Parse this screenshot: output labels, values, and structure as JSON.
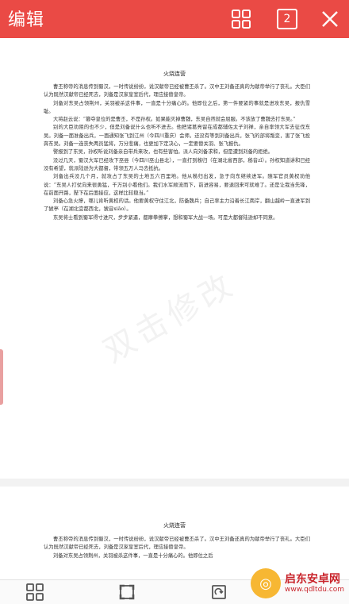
{
  "header": {
    "title": "编辑",
    "page_count": "2"
  },
  "document": {
    "title": "火烧连营",
    "paragraphs": [
      "曹丕称帝的消息传到蜀汉，一时传说纷纷，说汉献帝已经被曹丕杀了。汉中王刘备还真的为献帝举行了丧礼。大臣们认为既然汉献帝已经死去，刘备是汉家皇室后代，理应接替皇帝。",
      "刘备对东吴占领荆州，关羽被杀这件事，一直是十分痛心的。他即位之后，第一件要紧的事就是进攻东吴，报仇雪耻。",
      "大将赵云说：“篡夺皇位的是曹丕，不是孙权。如果能灭掉曹魏，东吴自然就会屈服。不该放了曹魏去打东吴。”",
      "别的大臣劝阻的也不少，但是刘备说什么也听不进去。他把诸葛亮留在成都辅佐太子刘禅，亲自率领大军去征伐东吴。刘备一面准备出兵，一面通知张飞到江州（今四川重庆）会师。还没有等到刘备出兵，张飞的部将叛变，害了张飞投奔东吴。刘备一连丧失两员猛将，万分悲痛，也更加下定决心，一定要替关羽、张飞报仇。",
      "警报到了东吴，孙权听说刘备亲自带兵来攻，也有些害怕。派人向刘备求和，但是遭到刘备的拒绝。",
      "没过几天，蜀汉大军已经攻下巫县（今四川巫山县北），一直打到秭归（在湖北省西部，秭音zǐ）。孙权知道讲和已经没有希望，就派陆逊为大都督，带领五万人马去抵抗。",
      "刘备出兵没几个月，就攻占了东吴的土地五六百里地。他从秭归出发，急于向东继续进军。随军官员黄权劝他说：“东吴人打仗向来很勇猛，千万别小看他们。我们水军顺流而下，前进容易，要退回来可就难了。还是让我当先锋，在前面开路，陛下在后面接应，这样比较稳当。”",
      "刘备心急火燎，哪儿肯听黄权的话。他要黄权守住江北，防备魏兵；自己率主力沿着长江南岸，翻山越岭一直进军到了猇亭（在湖北宜都西北，猇音xiāo）。",
      "东吴将士看到蜀军得寸进尺，步步紧逼，都摩拳擦掌，想和蜀军大战一场。可是大都督陆逊却不同意。"
    ],
    "page2_title": "火烧连营",
    "page2_paragraphs": [
      "曹丕称帝的消息传到蜀汉，一时传说纷纷，说汉献帝已经被曹丕杀了。汉中王刘备还真的为献帝举行了丧礼。大臣们认为既然汉献帝已经死去，刘备是汉家皇室后代，理应接替皇帝。",
      "刘备对东吴占领荆州，关羽被杀这件事，一直是十分痛心的。他即位之后"
    ]
  },
  "overlay": {
    "watermark": "双击修改",
    "site_name": "启东安卓网",
    "site_url": "www.qdltdu.com"
  },
  "colors": {
    "accent": "#ea4a45"
  }
}
